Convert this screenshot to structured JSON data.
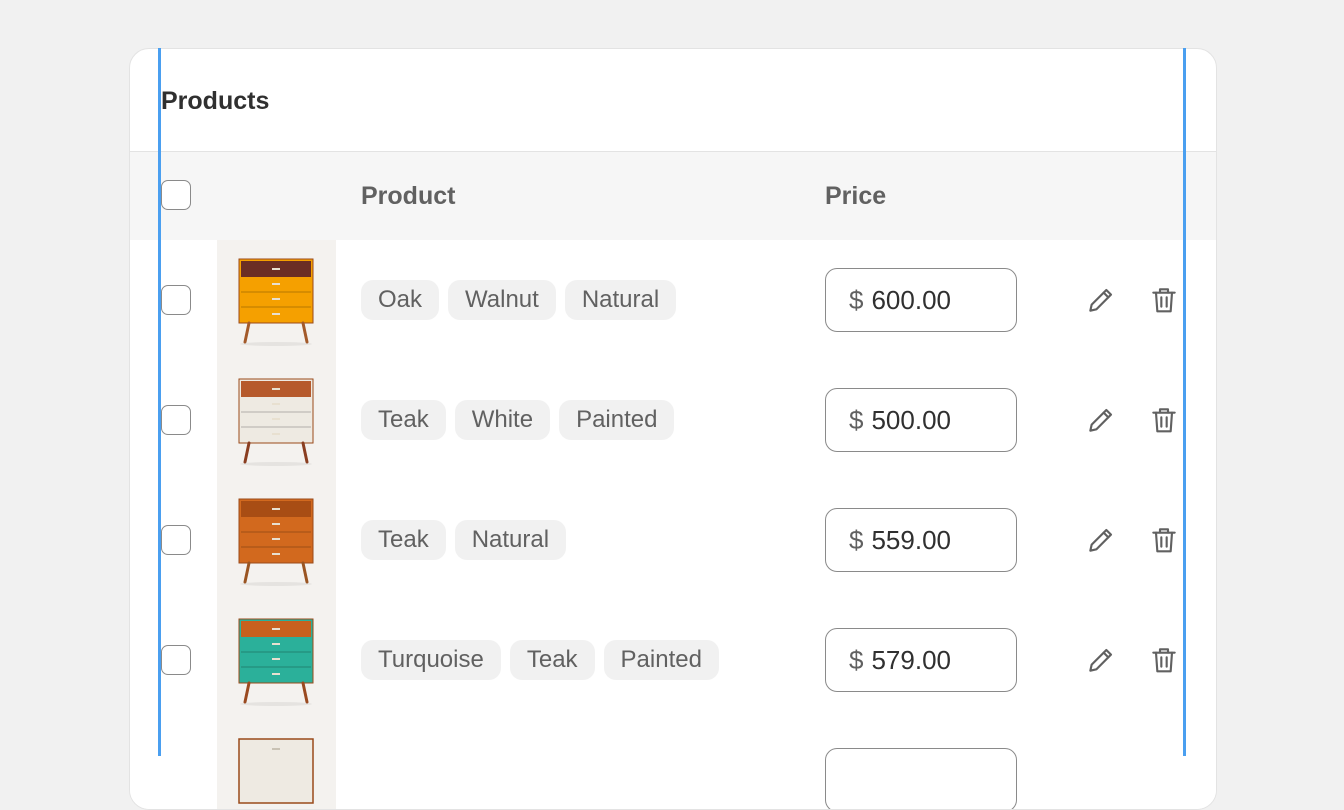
{
  "card": {
    "title": "Products"
  },
  "table": {
    "headers": {
      "product": "Product",
      "price": "Price"
    },
    "rows": [
      {
        "tags": [
          "Oak",
          "Walnut",
          "Natural"
        ],
        "currency": "$",
        "price": "600.00",
        "thumb": {
          "body": "#f5a000",
          "drawer": "#e58a00",
          "top": "#6b2e24",
          "legs": "#a35a2a"
        }
      },
      {
        "tags": [
          "Teak",
          "White",
          "Painted"
        ],
        "currency": "$",
        "price": "500.00",
        "thumb": {
          "body": "#eeeae2",
          "drawer": "#e6e2d8",
          "top": "#b65a2c",
          "legs": "#8a3e20"
        }
      },
      {
        "tags": [
          "Teak",
          "Natural"
        ],
        "currency": "$",
        "price": "559.00",
        "thumb": {
          "body": "#d2691e",
          "drawer": "#c45e18",
          "top": "#a84d14",
          "legs": "#9a5522"
        }
      },
      {
        "tags": [
          "Turquoise",
          "Teak",
          "Painted"
        ],
        "currency": "$",
        "price": "579.00",
        "thumb": {
          "body": "#2bb09a",
          "drawer": "#25a08b",
          "top": "#c8601e",
          "legs": "#9a4a20"
        }
      }
    ]
  },
  "icons": {
    "edit": "pencil-icon",
    "delete": "trash-icon"
  },
  "colors": {
    "guide": "#4a9ff0",
    "text_strong": "#303030",
    "text_muted": "#616161"
  }
}
